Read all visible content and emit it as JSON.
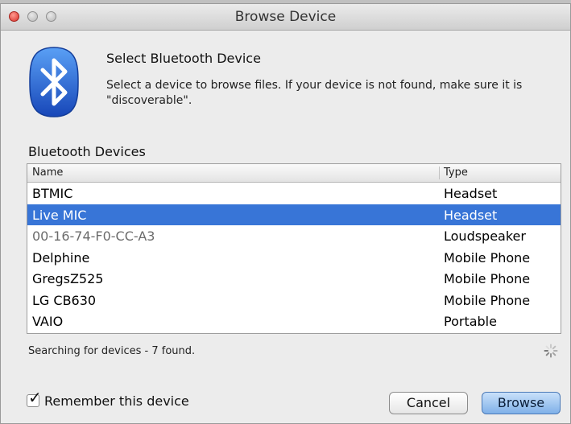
{
  "window": {
    "title": "Browse Device"
  },
  "header": {
    "heading": "Select Bluetooth Device",
    "description": "Select a device to browse files.  If your device is not found, make sure it is \"discoverable\"."
  },
  "devices": {
    "section_label": "Bluetooth Devices",
    "columns": {
      "name": "Name",
      "type": "Type"
    },
    "rows": [
      {
        "name": "BTMIC",
        "type": "Headset"
      },
      {
        "name": "Live MIC",
        "type": "Headset"
      },
      {
        "name": "00-16-74-F0-CC-A3",
        "type": "Loudspeaker"
      },
      {
        "name": "Delphine",
        "type": "Mobile Phone"
      },
      {
        "name": "GregsZ525",
        "type": "Mobile Phone"
      },
      {
        "name": "LG CB630",
        "type": "Mobile Phone"
      },
      {
        "name": "VAIO",
        "type": "Portable"
      }
    ],
    "selected_index": 1
  },
  "status": {
    "text": "Searching for devices - 7 found."
  },
  "footer": {
    "remember_label": "Remember this device",
    "remember_checked": true,
    "cancel_label": "Cancel",
    "browse_label": "Browse"
  },
  "icons": {
    "bluetooth": "bluetooth-icon",
    "spinner": "spinner-icon",
    "checkmark": "checkmark-icon"
  },
  "colors": {
    "selection": "#3875d7",
    "bluetooth_blue": "#1c5fd0",
    "close_red": "#d9302a"
  }
}
